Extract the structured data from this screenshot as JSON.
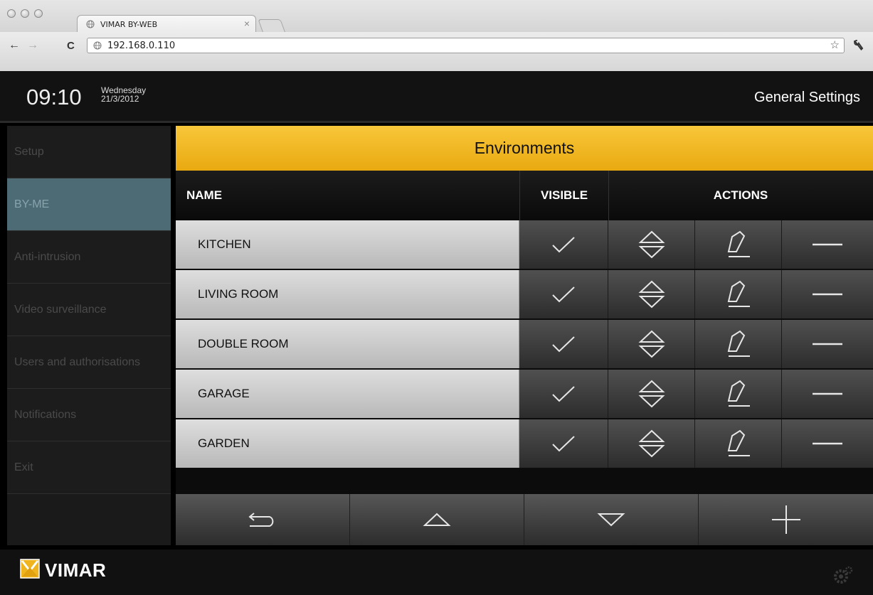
{
  "browser": {
    "tab_title": "VIMAR BY-WEB",
    "tab_close": "×",
    "url": "192.168.0.110",
    "back": "←",
    "forward": "→",
    "reload": "C",
    "bookmark": "☆",
    "wrench": "🔧"
  },
  "header": {
    "time": "09:10",
    "weekday": "Wednesday",
    "date": "21/3/2012",
    "page_title": "General Settings"
  },
  "sidebar": {
    "items": [
      {
        "label": "Setup"
      },
      {
        "label": "BY-ME"
      },
      {
        "label": "Anti-intrusion"
      },
      {
        "label": "Video surveillance"
      },
      {
        "label": "Users and authorisations"
      },
      {
        "label": "Notifications"
      },
      {
        "label": "Exit"
      }
    ],
    "active_index": 1
  },
  "main": {
    "banner": "Environments",
    "columns": {
      "name": "NAME",
      "visible": "VISIBLE",
      "actions": "ACTIONS"
    },
    "rows": [
      {
        "name": "KITCHEN"
      },
      {
        "name": "LIVING ROOM"
      },
      {
        "name": "DOUBLE ROOM"
      },
      {
        "name": "GARAGE"
      },
      {
        "name": "GARDEN"
      }
    ]
  },
  "footer": {
    "brand": "VIMAR"
  },
  "colors": {
    "accent": "#f0b51e",
    "active_item": "#4d6b75"
  },
  "icons": [
    "check-icon",
    "reorder-icon",
    "edit-icon",
    "remove-icon",
    "back-icon",
    "up-icon",
    "down-icon",
    "add-icon",
    "gear-icon"
  ]
}
